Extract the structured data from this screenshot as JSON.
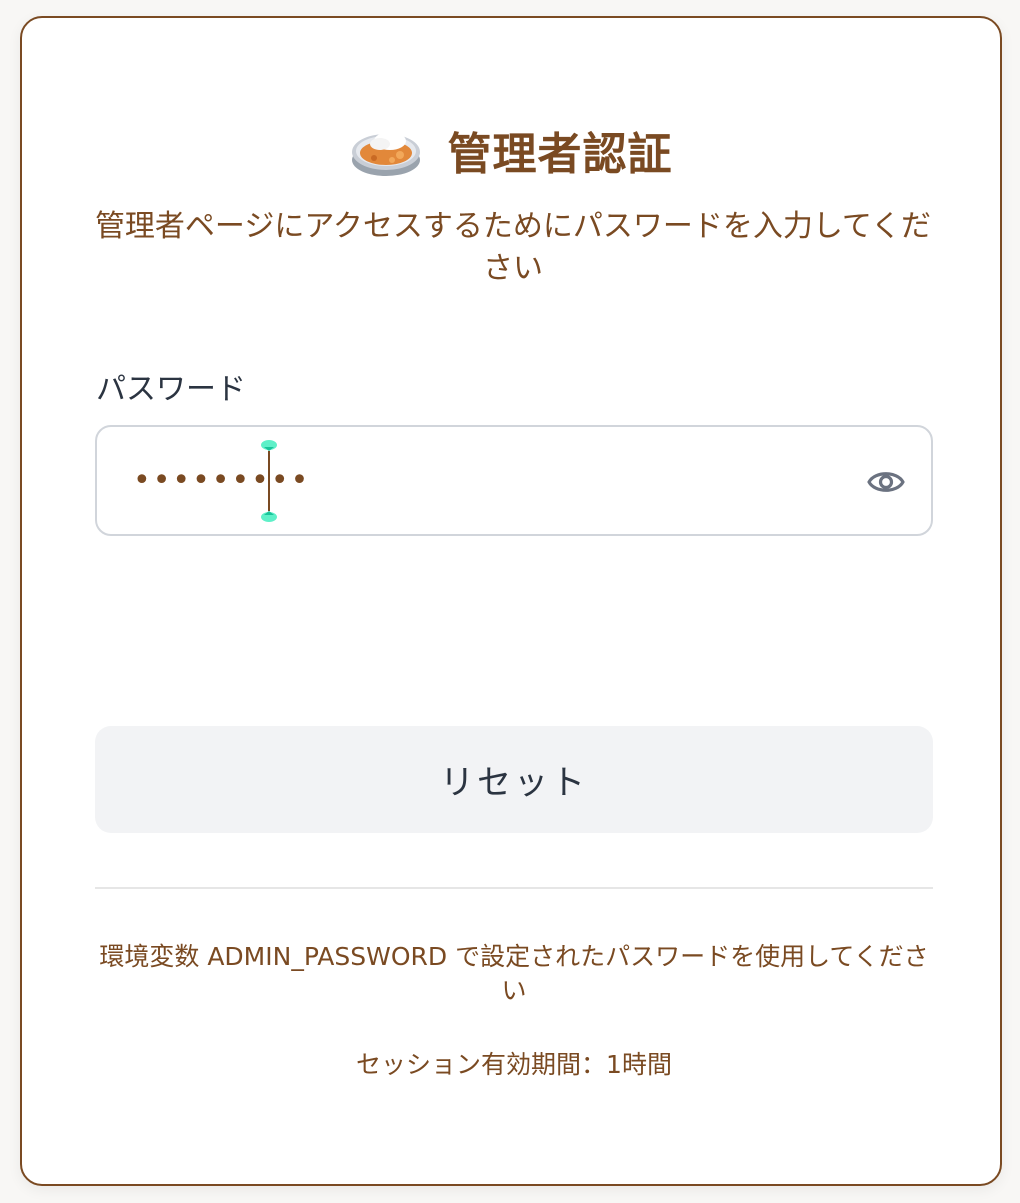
{
  "header": {
    "icon": "curry-rice-icon",
    "title": "管理者認証",
    "subtitle": "管理者ページにアクセスするためにパスワードを入力してください"
  },
  "form": {
    "password_label": "パスワード",
    "password_value": "•••••••••",
    "toggle_icon": "eye-icon",
    "reset_label": "リセット"
  },
  "footer": {
    "note": "環境変数 ADMIN_PASSWORD で設定されたパスワードを使用してください",
    "session": "セッション有効期間：1時間"
  },
  "colors": {
    "accent": "#7a4a22",
    "text_dark": "#2b3441",
    "button_bg": "#f2f3f5",
    "input_border": "#d1d5db"
  }
}
